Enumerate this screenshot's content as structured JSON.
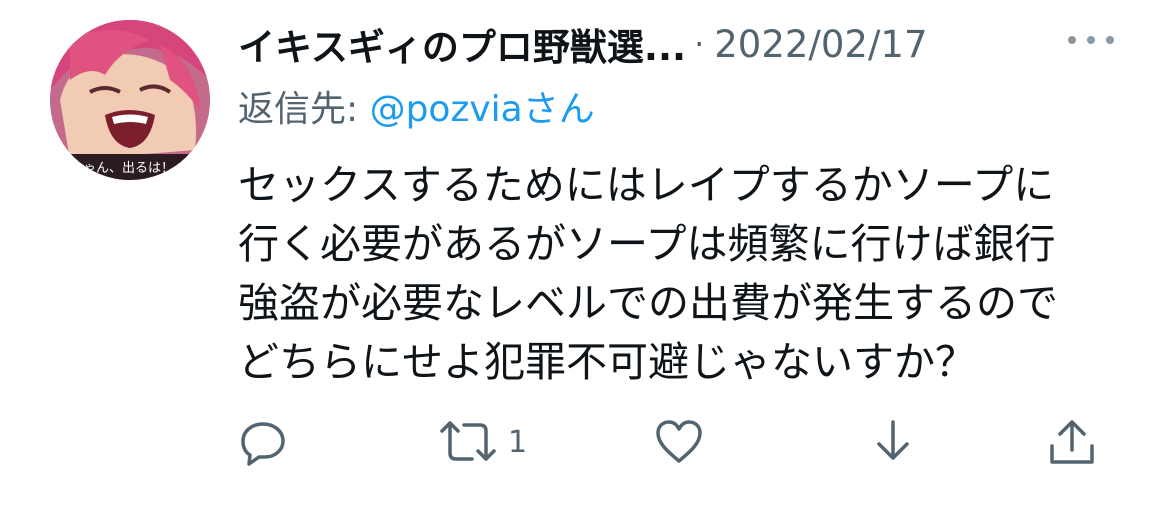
{
  "tweet": {
    "display_name": "イキスギィのプロ野獣選...",
    "separator": "·",
    "date": "2022/02/17",
    "reply_prefix": "返信先: ",
    "reply_handle": "@pozvia",
    "reply_suffix": "さん",
    "body_lines": [
      "セックスするためにはレイプするかソープに",
      "行く必要があるがソープは頻繁に行けば銀行",
      "強盗が必要なレベルでの出費が発生するので",
      "どちらにせよ犯罪不可避じゃないすか？"
    ],
    "avatar_caption": "ちゃん、出るは！"
  },
  "actions": {
    "reply_icon": "reply-icon",
    "retweet_icon": "retweet-icon",
    "retweet_count": "1",
    "like_icon": "heart-icon",
    "bookmark_icon": "download-icon",
    "share_icon": "share-icon"
  },
  "colors": {
    "text_primary": "#0f1419",
    "text_secondary": "#536471",
    "link": "#1d9bf0",
    "icon": "#536471"
  }
}
